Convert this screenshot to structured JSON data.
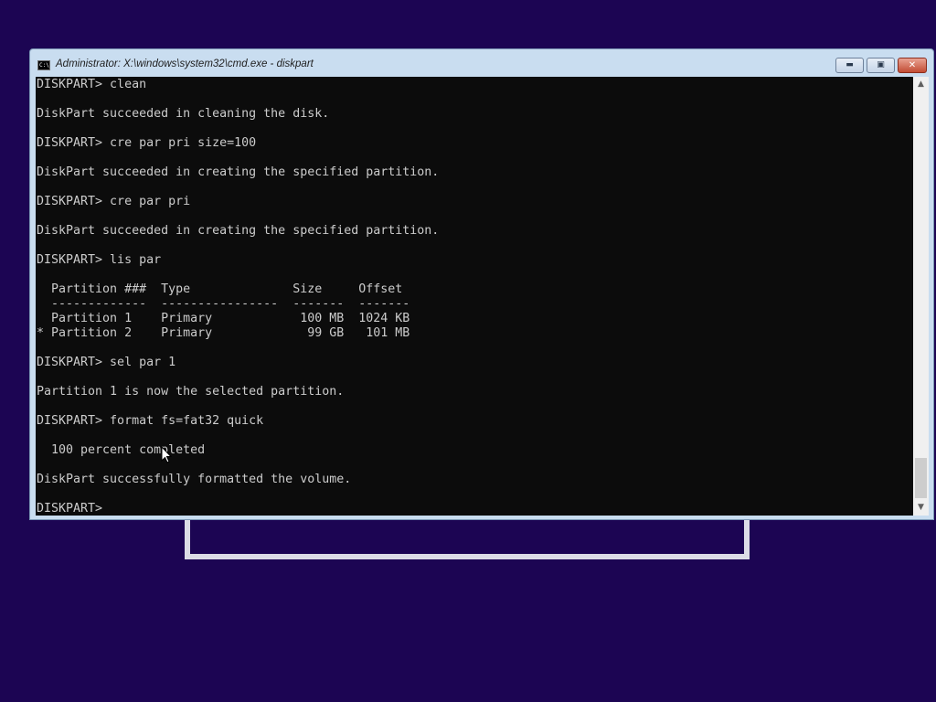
{
  "window": {
    "title": "Administrator: X:\\windows\\system32\\cmd.exe - diskpart",
    "icon": "cmd-icon",
    "icon_text": "C:\\",
    "buttons": {
      "minimize": "minimize-icon",
      "maximize": "maximize-icon",
      "close": "close-icon"
    }
  },
  "console": {
    "lines": [
      "DISKPART> clean",
      "",
      "DiskPart succeeded in cleaning the disk.",
      "",
      "DISKPART> cre par pri size=100",
      "",
      "DiskPart succeeded in creating the specified partition.",
      "",
      "DISKPART> cre par pri",
      "",
      "DiskPart succeeded in creating the specified partition.",
      "",
      "DISKPART> lis par",
      "",
      "  Partition ###  Type              Size     Offset",
      "  -------------  ----------------  -------  -------",
      "  Partition 1    Primary            100 MB  1024 KB",
      "* Partition 2    Primary             99 GB   101 MB",
      "",
      "DISKPART> sel par 1",
      "",
      "Partition 1 is now the selected partition.",
      "",
      "DISKPART> format fs=fat32 quick",
      "",
      "  100 percent completed",
      "",
      "DiskPart successfully formatted the volume.",
      "",
      "DISKPART> "
    ]
  },
  "colors": {
    "desktop_background": "#1c0553",
    "console_background": "#0c0c0c",
    "console_text": "#cccccc",
    "window_frame": "#c9ddf0",
    "close_button": "#c24c34"
  }
}
